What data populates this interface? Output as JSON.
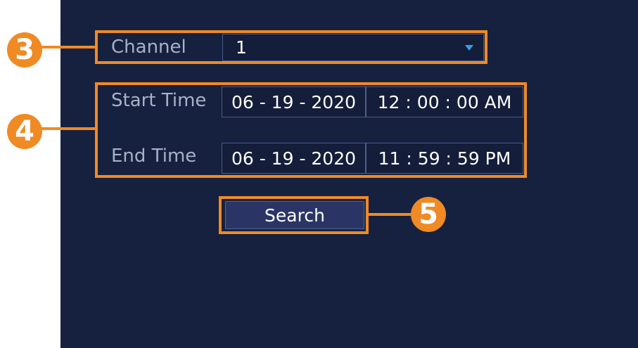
{
  "channel": {
    "label": "Channel",
    "value": "1"
  },
  "start_time": {
    "label": "Start Time",
    "date": "06 - 19 - 2020",
    "time": "12 : 00 : 00 AM"
  },
  "end_time": {
    "label": "End Time",
    "date": "06 - 19 - 2020",
    "time": "11 : 59 : 59 PM"
  },
  "search": {
    "label": "Search"
  },
  "callouts": [
    "3",
    "4",
    "5"
  ],
  "colors": {
    "panel_bg": "#16213f",
    "callout": "#f08a24",
    "label_text": "#a9b1c6",
    "dropdown_arrow": "#2ea3e8"
  },
  "icons": {
    "dropdown": "chevron-down-icon"
  }
}
